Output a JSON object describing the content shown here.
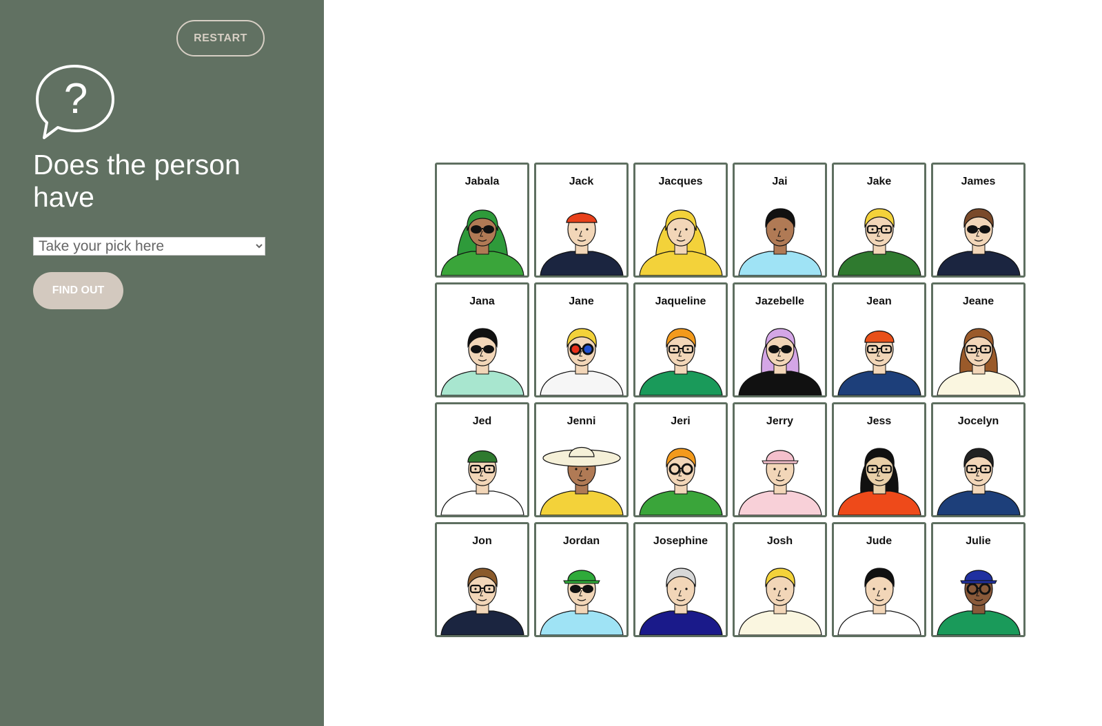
{
  "sidebar": {
    "restart_label": "RESTART",
    "question_icon": "question-speech-bubble-icon",
    "question_text": "Does the person have",
    "select_placeholder": "Take your pick here",
    "find_out_label": "FIND OUT"
  },
  "board": {
    "cards": [
      {
        "name": "Jabala",
        "skin": "#b07a55",
        "hair": "#2e9a3a",
        "shirt": "#3aa53a",
        "hat": "hijab",
        "glasses": "sun"
      },
      {
        "name": "Jack",
        "skin": "#f2d6b8",
        "hair": "#8a5a2b",
        "shirt": "#1b2540",
        "hat": "bandana",
        "glasses": "none"
      },
      {
        "name": "Jacques",
        "skin": "#f2d6b8",
        "hair": "#f3d23a",
        "shirt": "#f3d23a",
        "hat": "hood",
        "glasses": "none"
      },
      {
        "name": "Jai",
        "skin": "#b07a55",
        "hair": "#111111",
        "shirt": "#9fe3f5",
        "hat": "none",
        "glasses": "none"
      },
      {
        "name": "Jake",
        "skin": "#f2d6b8",
        "hair": "#f3d23a",
        "shirt": "#2f7a2f",
        "hat": "none",
        "glasses": "regular"
      },
      {
        "name": "James",
        "skin": "#f2d6b8",
        "hair": "#7a4a2a",
        "shirt": "#1b2540",
        "hat": "none",
        "glasses": "sun"
      },
      {
        "name": "Jana",
        "skin": "#f2d6b8",
        "hair": "#111111",
        "shirt": "#a8e6cf",
        "hat": "none",
        "glasses": "sun"
      },
      {
        "name": "Jane",
        "skin": "#f2d6b8",
        "hair": "#f3d23a",
        "shirt": "#f6f6f6",
        "hat": "none",
        "glasses": "round"
      },
      {
        "name": "Jaqueline",
        "skin": "#f2d6b8",
        "hair": "#f39a1c",
        "shirt": "#1a9a5a",
        "hat": "none",
        "glasses": "regular"
      },
      {
        "name": "Jazebelle",
        "skin": "#f2d6b8",
        "hair": "#d4a6e6",
        "shirt": "#111111",
        "hat": "none",
        "glasses": "sun"
      },
      {
        "name": "Jean",
        "skin": "#f2d6b8",
        "hair": "#e85a2a",
        "shirt": "#1d3f7a",
        "hat": "beanie",
        "glasses": "regular"
      },
      {
        "name": "Jeane",
        "skin": "#f2d6b8",
        "hair": "#9a5a2a",
        "shirt": "#faf6e0",
        "hat": "none",
        "glasses": "regular"
      },
      {
        "name": "Jed",
        "skin": "#f2d6b8",
        "hair": "#f39a1c",
        "shirt": "#ffffff",
        "hat": "beanie-green",
        "glasses": "regular"
      },
      {
        "name": "Jenni",
        "skin": "#b07a55",
        "hair": "#f5f0d8",
        "shirt": "#f3d23a",
        "hat": "sunhat",
        "glasses": "none"
      },
      {
        "name": "Jeri",
        "skin": "#f2d6b8",
        "hair": "#f39a1c",
        "shirt": "#3aa53a",
        "hat": "none",
        "glasses": "round"
      },
      {
        "name": "Jerry",
        "skin": "#f2d6b8",
        "hair": "#f0c0c8",
        "shirt": "#f8d0d8",
        "hat": "cap",
        "glasses": "none"
      },
      {
        "name": "Jess",
        "skin": "#e8cfa8",
        "hair": "#111111",
        "shirt": "#ee4a1a",
        "hat": "none",
        "glasses": "regular"
      },
      {
        "name": "Jocelyn",
        "skin": "#f2d6b8",
        "hair": "#222222",
        "shirt": "#1d3f7a",
        "hat": "none",
        "glasses": "regular"
      },
      {
        "name": "Jon",
        "skin": "#f2d6b8",
        "hair": "#8a5a2b",
        "shirt": "#1b2540",
        "hat": "none",
        "glasses": "regular"
      },
      {
        "name": "Jordan",
        "skin": "#f2d6b8",
        "hair": "#f3d23a",
        "shirt": "#9fe3f5",
        "hat": "cap-green",
        "glasses": "sun"
      },
      {
        "name": "Josephine",
        "skin": "#f2d6b8",
        "hair": "#d8d8d8",
        "shirt": "#1a1a8a",
        "hat": "none",
        "glasses": "none"
      },
      {
        "name": "Josh",
        "skin": "#f2d6b8",
        "hair": "#f3d23a",
        "shirt": "#faf6e0",
        "hat": "none",
        "glasses": "none"
      },
      {
        "name": "Jude",
        "skin": "#f2d6b8",
        "hair": "#111111",
        "shirt": "#ffffff",
        "hat": "none",
        "glasses": "none"
      },
      {
        "name": "Julie",
        "skin": "#8a5a3a",
        "hair": "#111111",
        "shirt": "#1a9a5a",
        "hat": "cap-blue",
        "glasses": "round"
      }
    ]
  }
}
